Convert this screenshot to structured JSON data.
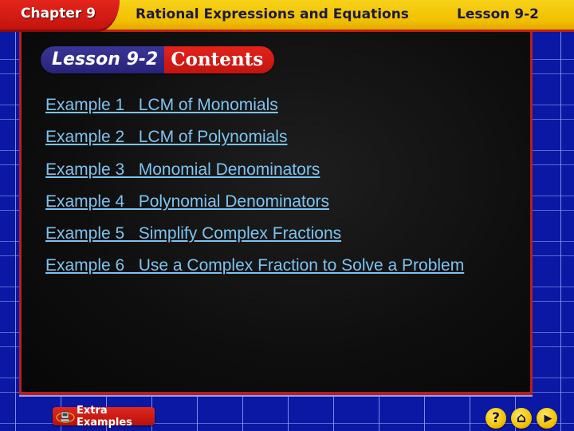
{
  "header": {
    "chapter": "Chapter 9",
    "title": "Rational Expressions and Equations",
    "lesson": "Lesson 9-2"
  },
  "contents_banner": {
    "lesson": "Lesson 9-2",
    "label": "Contents"
  },
  "examples": [
    {
      "number": "Example 1",
      "title": "LCM of Monomials",
      "text": "Example 1   LCM of Monomials"
    },
    {
      "number": "Example 2",
      "title": "LCM of Polynomials",
      "text": "Example 2   LCM of Polynomials"
    },
    {
      "number": "Example 3",
      "title": "Monomial Denominators",
      "text": "Example 3   Monomial Denominators"
    },
    {
      "number": "Example 4",
      "title": "Polynomial Denominators",
      "text": "Example 4   Polynomial Denominators"
    },
    {
      "number": "Example 5",
      "title": "Simplify Complex Fractions",
      "text": "Example 5   Simplify Complex Fractions"
    },
    {
      "number": "Example 6",
      "title": "Use a Complex Fraction to Solve a Problem",
      "text": "Example 6   Use a Complex Fraction to Solve a Problem"
    }
  ],
  "footer": {
    "extra_examples_label": "Extra Examples",
    "extra_examples_icon": "computer-icon",
    "nav": [
      {
        "icon": "help-icon",
        "glyph": "?"
      },
      {
        "icon": "home-icon",
        "glyph": "⌂"
      },
      {
        "icon": "next-icon",
        "glyph": "▶"
      }
    ]
  },
  "colors": {
    "link": "#7cc4f0",
    "header_yellow": "#f2c000",
    "chapter_red": "#d61c15",
    "frame_red": "#b81f1a",
    "background_blue": "#0a18a3",
    "pill_blue": "#2f2a88"
  }
}
